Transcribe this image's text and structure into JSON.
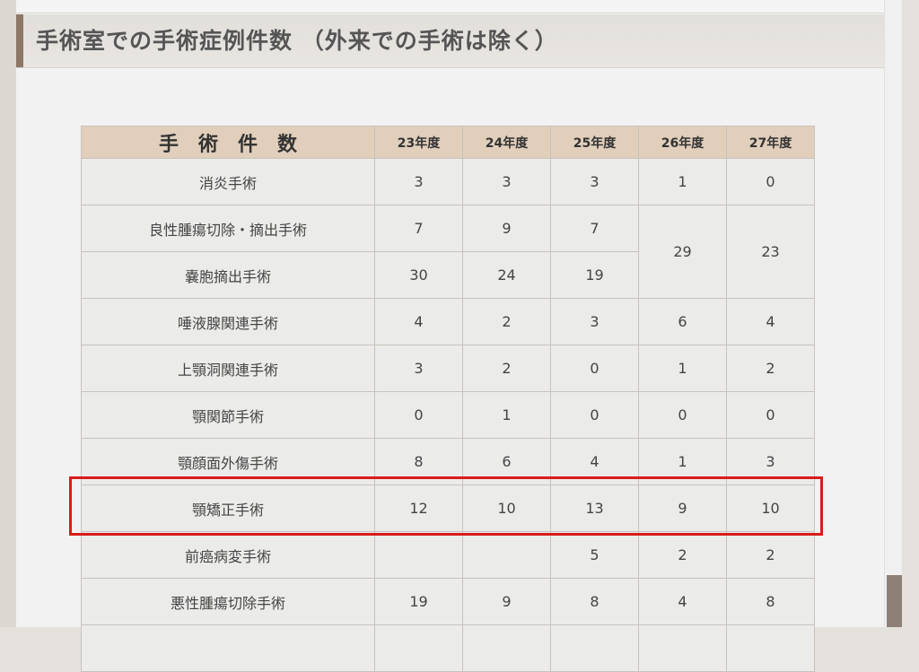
{
  "section": {
    "title": "手術室での手術症例件数 （外来での手術は除く）"
  },
  "table": {
    "header": {
      "label": "手術件数",
      "years": [
        "23年度",
        "24年度",
        "25年度",
        "26年度",
        "27年度"
      ]
    },
    "rows": [
      {
        "label": "消炎手術",
        "values": [
          "3",
          "3",
          "3",
          "1",
          "0"
        ]
      },
      {
        "label": "良性腫瘍切除・摘出手術",
        "values": [
          "7",
          "9",
          "7",
          "29",
          "23"
        ]
      },
      {
        "label": "嚢胞摘出手術",
        "values": [
          "30",
          "24",
          "19"
        ]
      },
      {
        "label": "唾液腺関連手術",
        "values": [
          "4",
          "2",
          "3",
          "6",
          "4"
        ]
      },
      {
        "label": "上顎洞関連手術",
        "values": [
          "3",
          "2",
          "0",
          "1",
          "2"
        ]
      },
      {
        "label": "顎関節手術",
        "values": [
          "0",
          "1",
          "0",
          "0",
          "0"
        ]
      },
      {
        "label": "顎顔面外傷手術",
        "values": [
          "8",
          "6",
          "4",
          "1",
          "3"
        ]
      },
      {
        "label": "顎矯正手術",
        "values": [
          "12",
          "10",
          "13",
          "9",
          "10"
        ]
      },
      {
        "label": "前癌病変手術",
        "values": [
          "",
          "",
          "5",
          "2",
          "2"
        ]
      },
      {
        "label": "悪性腫瘍切除手術",
        "values": [
          "19",
          "9",
          "8",
          "4",
          "8"
        ]
      }
    ]
  },
  "highlight": {
    "row": "顎矯正手術",
    "color": "#d91c1c"
  },
  "colors": {
    "accent": "#8d7766",
    "header_bg": "#e1cfbb"
  }
}
